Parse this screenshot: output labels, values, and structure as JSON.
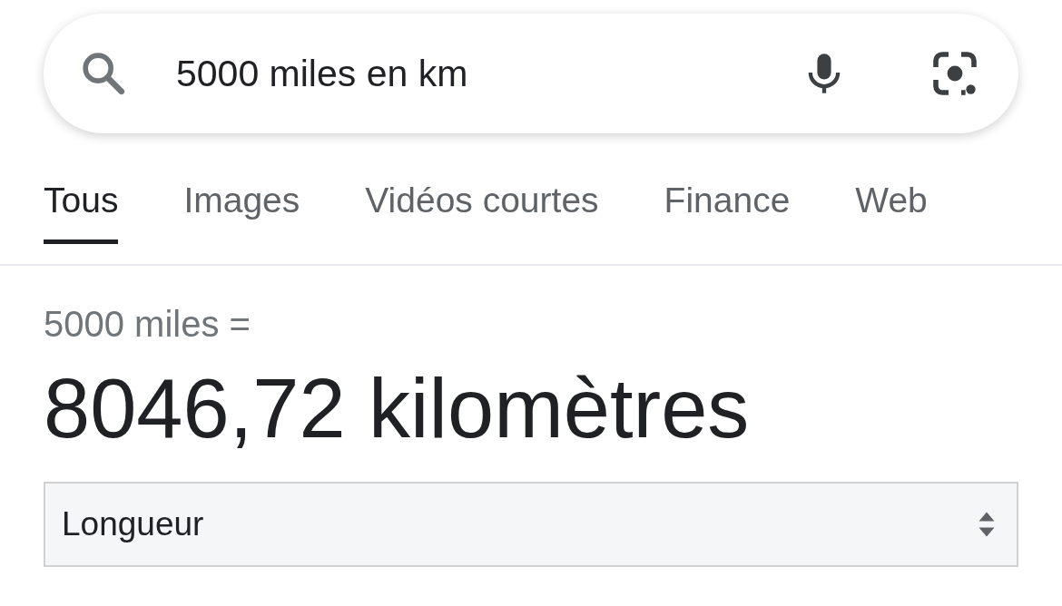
{
  "search": {
    "value": "5000 miles en km"
  },
  "tabs": [
    {
      "label": "Tous",
      "selected": true
    },
    {
      "label": "Images",
      "selected": false
    },
    {
      "label": "Vidéos courtes",
      "selected": false
    },
    {
      "label": "Finance",
      "selected": false
    },
    {
      "label": "Web",
      "selected": false
    }
  ],
  "result": {
    "query": "5000 miles =",
    "answer": "8046,72 kilomètres"
  },
  "unit_select": {
    "value": "Longueur"
  }
}
